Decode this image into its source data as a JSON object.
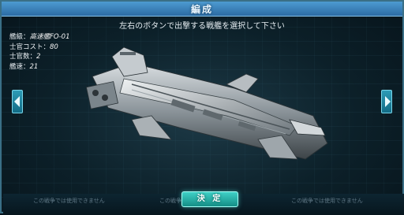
{
  "window": {
    "title": "編成"
  },
  "instruction": "左右のボタンで出撃する戦艦を選択して下さい",
  "ship_stats": {
    "class_label": "艦級：",
    "class_value": "高速艦FO-01",
    "officer_cost_label": "士官コスト：",
    "officer_cost_value": "80",
    "officer_count_label": "士官数：",
    "officer_count_value": "2",
    "speed_label": "艦速：",
    "speed_value": "21"
  },
  "slots": {
    "left": "この戦争では使用できません",
    "center": "この戦争では使用できません",
    "right": "この戦争では使用できません"
  },
  "buttons": {
    "decide_label": "決 定"
  },
  "icons": {
    "prev": "left-arrow-icon",
    "next": "right-arrow-icon"
  },
  "colors": {
    "title_bar": "#3a84bf",
    "accent": "#2fb8b0"
  }
}
